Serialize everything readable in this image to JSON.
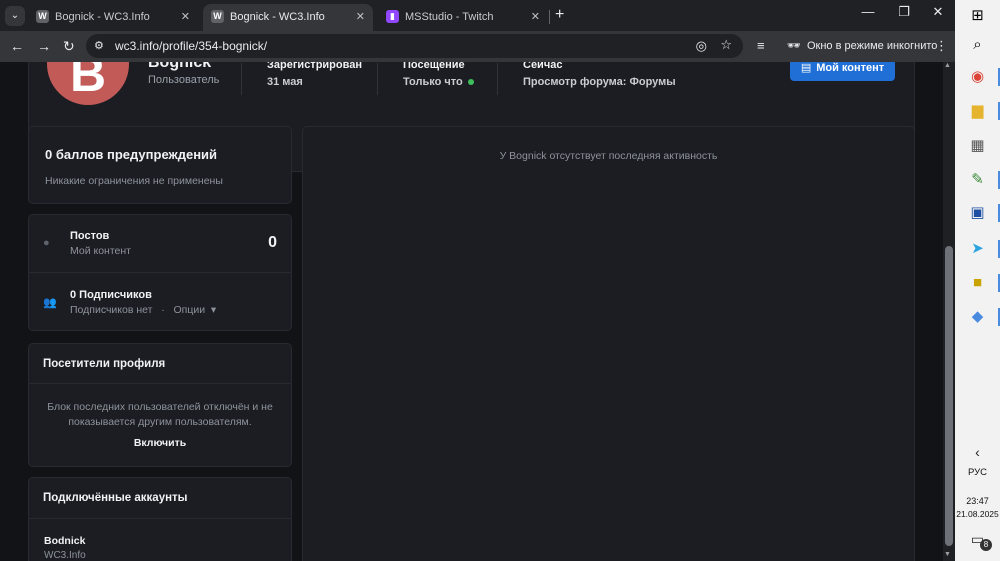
{
  "browser": {
    "tabs": [
      {
        "title": "Bognick - WC3.Info",
        "favicon": "W",
        "active": false
      },
      {
        "title": "Bognick - WC3.Info",
        "favicon": "W",
        "active": true
      },
      {
        "title": "MSStudio - Twitch",
        "favicon": "twitch-icon",
        "active": false
      }
    ],
    "url": "wc3.info/profile/354-bognick/",
    "incognito_label": "Окно в режиме инкогнито",
    "accent": "#9146ff"
  },
  "profile": {
    "avatar_letter": "B",
    "avatar_color": "#c25a58",
    "name": "Bognick",
    "role": "Пользователь",
    "stats": [
      {
        "label": "Зарегистрирован",
        "value": "31 мая"
      },
      {
        "label": "Посещение",
        "value": "Только что"
      },
      {
        "label": "Сейчас",
        "value": "Просмотр форума: Форумы"
      }
    ],
    "my_content_label": "Мой контент",
    "my_content_color": "#1f6fd6"
  },
  "warnings": {
    "title": "0 баллов предупреждений",
    "subtitle": "Никакие ограничения не применены"
  },
  "posts": {
    "title": "Постов",
    "subtitle": "Мой контент",
    "count": "0"
  },
  "followers": {
    "title": "0 Подписчиков",
    "subtitle": "Подписчиков нет",
    "options_label": "Опции"
  },
  "visitors": {
    "title": "Посетители профиля",
    "text": "Блок последних пользователей отключён и не показывается другим пользователям.",
    "enable_label": "Включить"
  },
  "accounts": {
    "title": "Подключённые аккаунты",
    "items": [
      {
        "name": "Bodnick",
        "site": "WC3.Info"
      }
    ]
  },
  "activity": {
    "message": "У Bognick отсутствует последняя активность"
  },
  "taskbar": {
    "language": "РУС",
    "time": "23:47",
    "date": "21.08.2025",
    "notifications": "8"
  }
}
